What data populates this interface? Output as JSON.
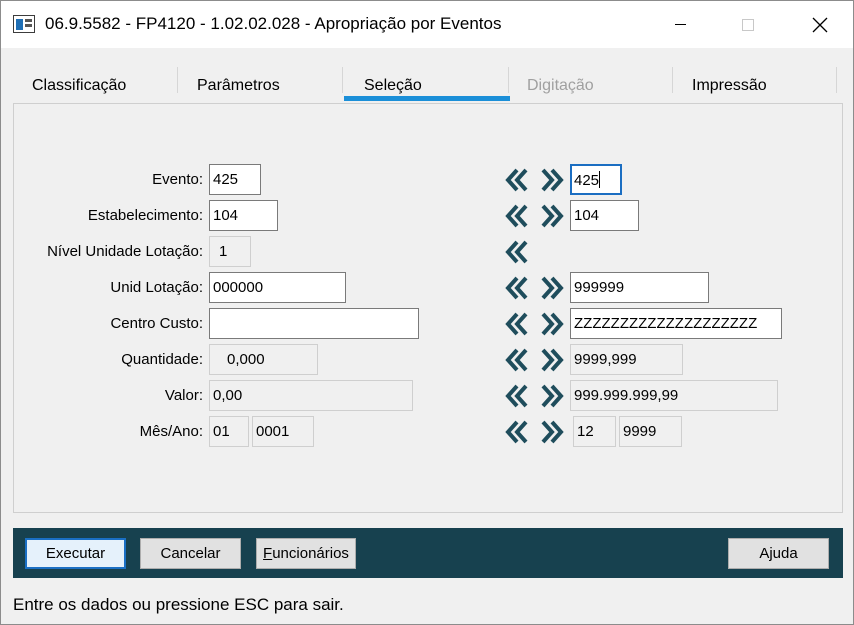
{
  "window": {
    "title": "06.9.5582 - FP4120 - 1.02.02.028 - Apropriação por Eventos",
    "icon": "app-window-icon"
  },
  "tabs": [
    {
      "label": "Classificação",
      "state": "normal"
    },
    {
      "label": "Parâmetros",
      "state": "normal"
    },
    {
      "label": "Seleção",
      "state": "selected"
    },
    {
      "label": "Digitação",
      "state": "disabled"
    },
    {
      "label": "Impressão",
      "state": "normal"
    }
  ],
  "form": {
    "evento": {
      "label": "Evento:",
      "from": "425",
      "to": "425"
    },
    "estabelecimento": {
      "label": "Estabelecimento:",
      "from": "104",
      "to": "104"
    },
    "nivel": {
      "label": "Nível Unidade Lotação:",
      "value": "1"
    },
    "unid_lotacao": {
      "label": "Unid Lotação:",
      "from": "000000",
      "to": "999999"
    },
    "centro_custo": {
      "label": "Centro Custo:",
      "from": "",
      "to": "ZZZZZZZZZZZZZZZZZZZZ"
    },
    "quantidade": {
      "label": "Quantidade:",
      "from": "0,000",
      "to": "9999,999"
    },
    "valor": {
      "label": "Valor:",
      "from": "0,00",
      "to": "999.999.999,99"
    },
    "mes_ano": {
      "label": "Mês/Ano:",
      "from_mes": "01",
      "from_ano": "0001",
      "to_mes": "12",
      "to_ano": "9999"
    }
  },
  "buttons": {
    "executar": "Executar",
    "cancelar": "Cancelar",
    "funcionarios_first": "F",
    "funcionarios_rest": "uncionários",
    "ajuda": "Ajuda"
  },
  "status_text": "Entre os dados ou pressione ESC para sair.",
  "colors": {
    "accent_tab": "#1b8fd8",
    "button_bar": "#17414f",
    "arrow": "#1f4d5c"
  }
}
